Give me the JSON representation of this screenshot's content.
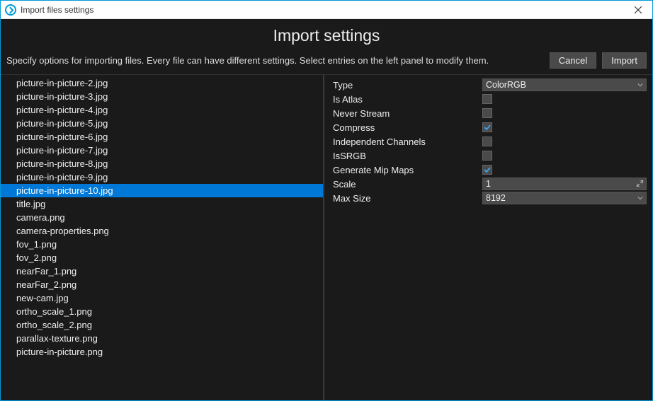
{
  "window": {
    "title": "Import files settings"
  },
  "heading": "Import settings",
  "subhead": "Specify options for importing files. Every file can have different settings. Select entries on the left panel to modify them.",
  "buttons": {
    "cancel": "Cancel",
    "import": "Import"
  },
  "files": [
    "picture-in-picture-2.jpg",
    "picture-in-picture-3.jpg",
    "picture-in-picture-4.jpg",
    "picture-in-picture-5.jpg",
    "picture-in-picture-6.jpg",
    "picture-in-picture-7.jpg",
    "picture-in-picture-8.jpg",
    "picture-in-picture-9.jpg",
    "picture-in-picture-10.jpg",
    "title.jpg",
    "camera.png",
    "camera-properties.png",
    "fov_1.png",
    "fov_2.png",
    "nearFar_1.png",
    "nearFar_2.png",
    "new-cam.jpg",
    "ortho_scale_1.png",
    "ortho_scale_2.png",
    "parallax-texture.png",
    "picture-in-picture.png"
  ],
  "selectedIndex": 8,
  "props": {
    "type": {
      "label": "Type",
      "value": "ColorRGB"
    },
    "isAtlas": {
      "label": "Is Atlas",
      "value": false
    },
    "neverStream": {
      "label": "Never Stream",
      "value": false
    },
    "compress": {
      "label": "Compress",
      "value": true
    },
    "independentChannels": {
      "label": "Independent Channels",
      "value": false
    },
    "isSRGB": {
      "label": "IsSRGB",
      "value": false
    },
    "genMipMaps": {
      "label": "Generate Mip Maps",
      "value": true
    },
    "scale": {
      "label": "Scale",
      "value": "1"
    },
    "maxSize": {
      "label": "Max Size",
      "value": "8192"
    }
  }
}
